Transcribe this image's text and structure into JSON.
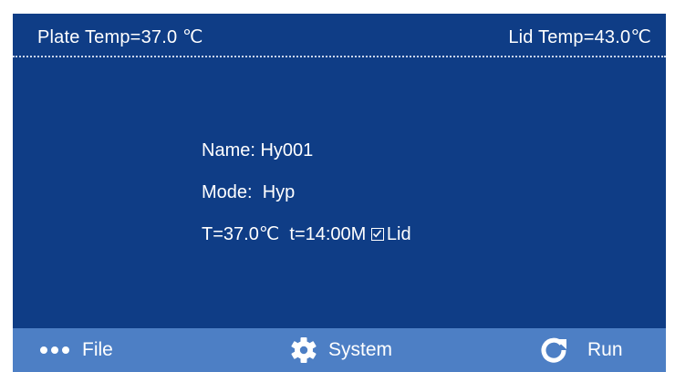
{
  "status": {
    "plate_temp": "Plate Temp=37.0 ℃",
    "lid_temp": "Lid Temp=43.0℃"
  },
  "program": {
    "name_line": "Name: Hy001",
    "mode_line": "Mode:  Hyp",
    "params": "T=37.0℃  t=14:00M ",
    "lid_label": "Lid",
    "lid_checked": true
  },
  "bottom_bar": {
    "file_label": "File",
    "file_icon": "more-dots-icon",
    "system_label": "System",
    "system_icon": "gear-icon",
    "run_label": "Run",
    "run_icon": "refresh-icon"
  },
  "colors": {
    "screen_bg": "#0f3d86",
    "bottom_bar_bg": "#4d7fc5",
    "text": "#ffffff"
  }
}
